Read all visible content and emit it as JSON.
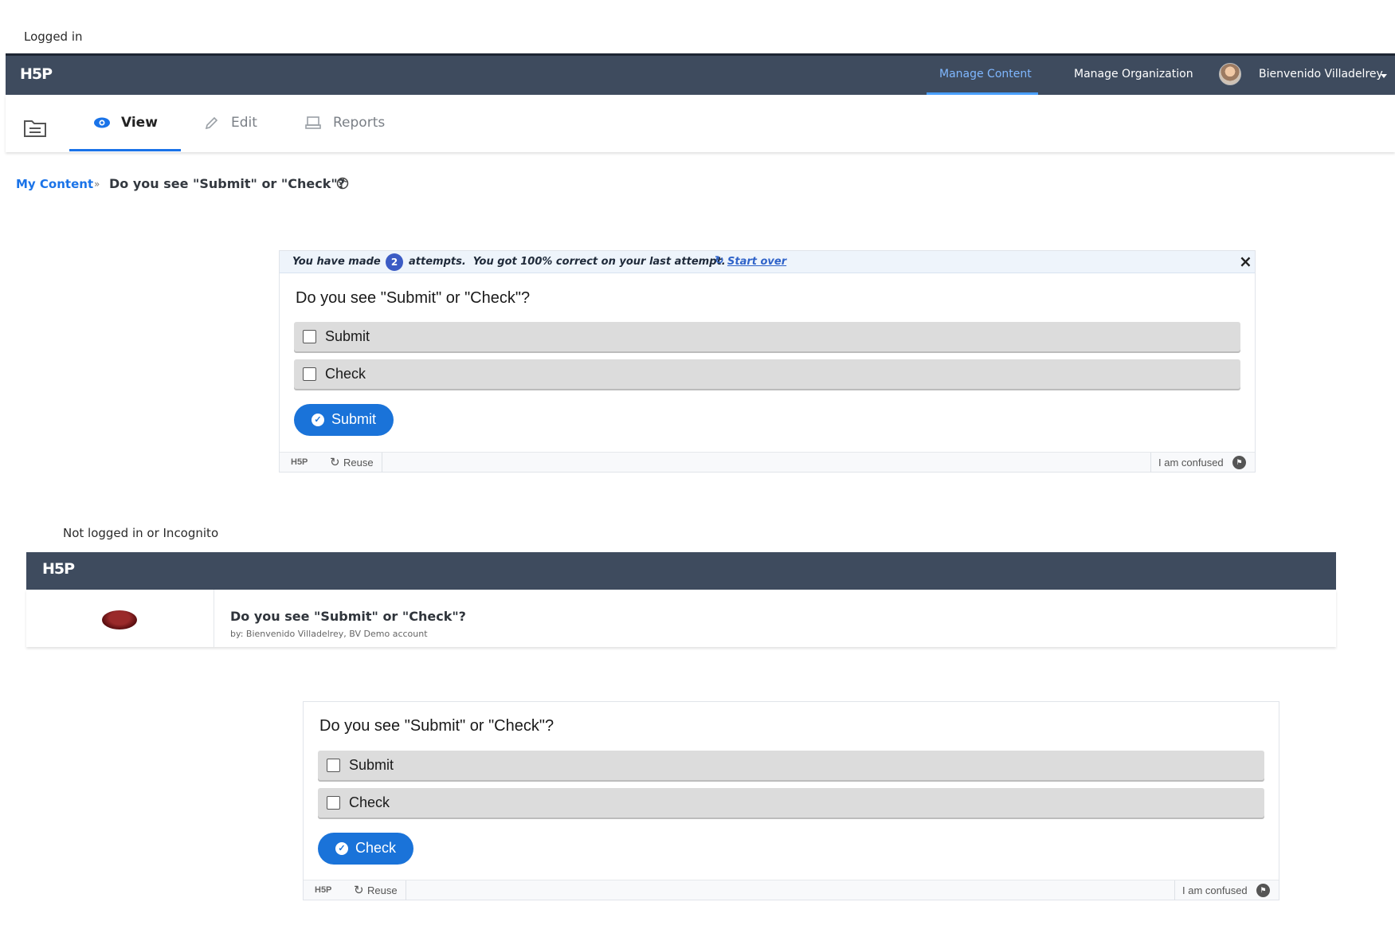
{
  "section1": {
    "label": "Logged in",
    "nav": {
      "logo": "H5P",
      "manage_content": "Manage Content",
      "manage_org": "Manage Organization",
      "user_name": "Bienvenido Villadelrey"
    },
    "tabs": [
      "View",
      "Edit",
      "Reports"
    ],
    "breadcrumb": {
      "link": "My Content",
      "sep": "»",
      "title": "Do you see \"Submit\" or \"Check\"?"
    },
    "attempt_bar": {
      "prefix": "You have made",
      "count": "2",
      "suffix": "attempts.  You got 100% correct on your last attempt.",
      "start_over": "Start over",
      "close": "×"
    },
    "question": "Do you see \"Submit\" or \"Check\"?",
    "answers": [
      "Submit",
      "Check"
    ],
    "button": "Submit",
    "footer": {
      "logo": "H5P",
      "reuse": "Reuse",
      "confused": "I am confused"
    }
  },
  "section2": {
    "label": "Not logged in or Incognito",
    "nav": {
      "logo": "H5P"
    },
    "info": {
      "title": "Do you see \"Submit\" or \"Check\"?",
      "byline": "by: Bienvenido Villadelrey, BV Demo account"
    },
    "question": "Do you see \"Submit\" or \"Check\"?",
    "answers": [
      "Submit",
      "Check"
    ],
    "button": "Check",
    "footer": {
      "logo": "H5P",
      "reuse": "Reuse",
      "confused": "I am confused"
    }
  },
  "colors": {
    "nav_bg": "#3e4b5e",
    "accent": "#1a73e8",
    "button": "#1a73d9"
  }
}
